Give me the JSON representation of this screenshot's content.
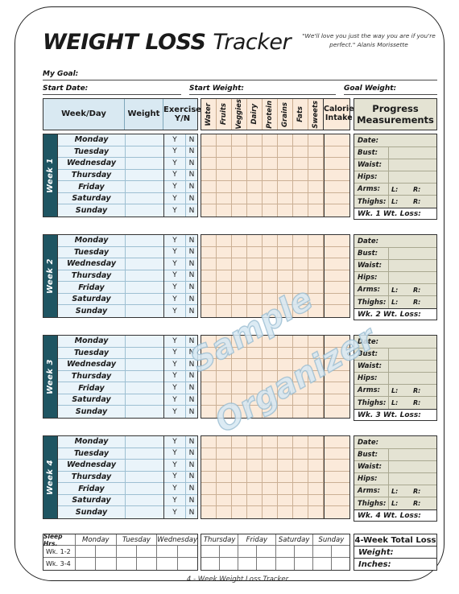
{
  "document": {
    "title_bold": "WEIGHT LOSS",
    "title_thin": "Tracker",
    "quote": "\"We'll love you just the way you are if you're perfect.\"  Alanis Morissette",
    "footer": "4 - Week Weight Loss Tracker",
    "watermark_line1": "Sample",
    "watermark_line2": "Organizer"
  },
  "fields": {
    "my_goal": "My Goal:",
    "start_date": "Start Date:",
    "start_weight": "Start Weight:",
    "goal_weight": "Goal Weight:"
  },
  "table_headers": {
    "week_day": "Week/Day",
    "weight": "Weight",
    "exercise": "Exercise Y/N",
    "calorie_intake": "Calorie Intake",
    "progress": "Progress Measurements",
    "food_columns": [
      "Water",
      "Fruits",
      "Veggies",
      "Dairy",
      "Protein",
      "Grains",
      "Fats",
      "Sweets"
    ]
  },
  "weeks": [
    {
      "label": "Week 1",
      "days": [
        "Monday",
        "Tuesday",
        "Wednesday",
        "Thursday",
        "Friday",
        "Saturday",
        "Sunday"
      ],
      "yes": "Y",
      "no": "N",
      "measurements": [
        "Date:",
        "Bust:",
        "Waist:",
        "Hips:",
        "Arms:",
        "Thighs:"
      ],
      "left_label": "L:",
      "right_label": "R:",
      "weekly_loss": "Wk. 1 Wt. Loss:"
    },
    {
      "label": "Week 2",
      "days": [
        "Monday",
        "Tuesday",
        "Wednesday",
        "Thursday",
        "Friday",
        "Saturday",
        "Sunday"
      ],
      "yes": "Y",
      "no": "N",
      "measurements": [
        "Date:",
        "Bust:",
        "Waist:",
        "Hips:",
        "Arms:",
        "Thighs:"
      ],
      "left_label": "L:",
      "right_label": "R:",
      "weekly_loss": "Wk. 2 Wt. Loss:"
    },
    {
      "label": "Week 3",
      "days": [
        "Monday",
        "Tuesday",
        "Wednesday",
        "Thursday",
        "Friday",
        "Saturday",
        "Sunday"
      ],
      "yes": "Y",
      "no": "N",
      "measurements": [
        "Date:",
        "Bust:",
        "Waist:",
        "Hips:",
        "Arms:",
        "Thighs:"
      ],
      "left_label": "L:",
      "right_label": "R:",
      "weekly_loss": "Wk. 3 Wt. Loss:"
    },
    {
      "label": "Week 4",
      "days": [
        "Monday",
        "Tuesday",
        "Wednesday",
        "Thursday",
        "Friday",
        "Saturday",
        "Sunday"
      ],
      "yes": "Y",
      "no": "N",
      "measurements": [
        "Date:",
        "Bust:",
        "Waist:",
        "Hips:",
        "Arms:",
        "Thighs:"
      ],
      "left_label": "L:",
      "right_label": "R:",
      "weekly_loss": "Wk. 4 Wt. Loss:"
    }
  ],
  "sleep": {
    "header": "Sleep Hrs.",
    "rows": [
      "Wk. 1-2",
      "Wk. 3-4"
    ],
    "days_left": [
      "Monday",
      "Tuesday",
      "Wednesday"
    ],
    "days_right": [
      "Thursday",
      "Friday",
      "Saturday",
      "Sunday"
    ]
  },
  "totals": {
    "header": "4-Week Total Loss",
    "weight": "Weight:",
    "inches": "Inches:"
  },
  "colors": {
    "teal": "#1f5562",
    "blue_header": "#d9e9f2",
    "blue_rows": "#eaf4fa",
    "peach": "#fbeada",
    "khaki": "#e4e3d3",
    "border": "#333333"
  }
}
